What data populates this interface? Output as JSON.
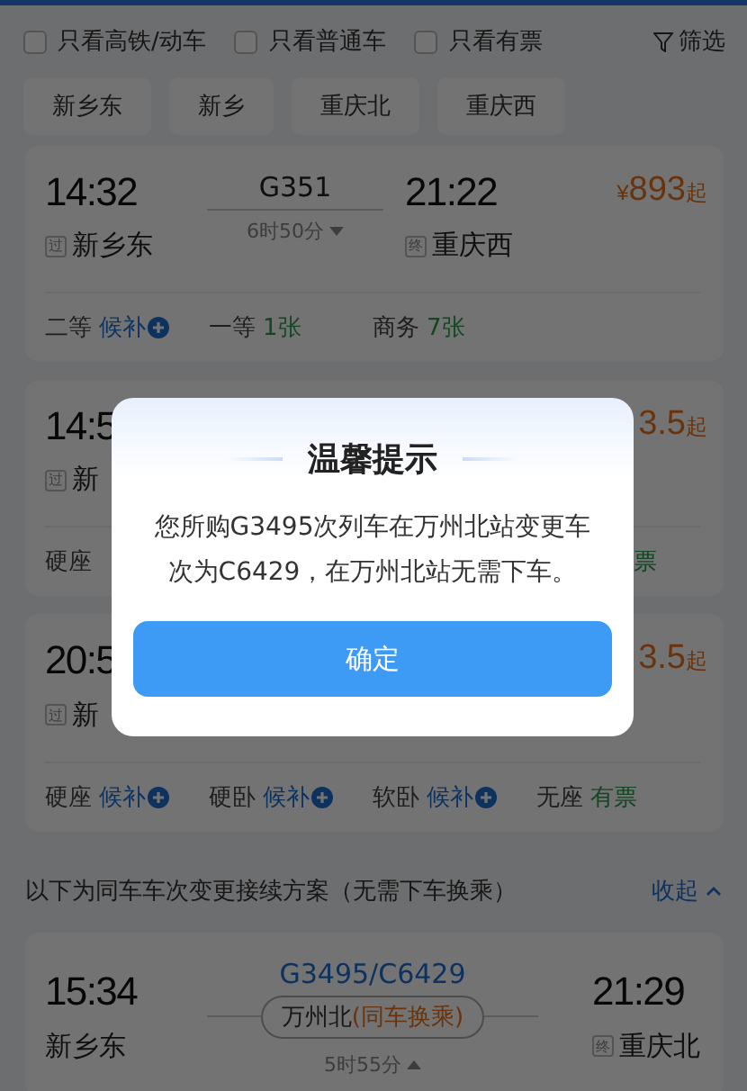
{
  "filters": [
    {
      "label": "只看高铁/动车",
      "checked": false
    },
    {
      "label": "只看普通车",
      "checked": false
    },
    {
      "label": "只看有票",
      "checked": false
    }
  ],
  "filter_button": "筛选",
  "stations": [
    "新乡东",
    "新乡",
    "重庆北",
    "重庆西"
  ],
  "trains": [
    {
      "kind": "full",
      "dep_time": "14:32",
      "dep_badge": "过",
      "dep_station": "新乡东",
      "train": "G351",
      "duration": "6时50分",
      "arr_time": "21:22",
      "arr_badge": "终",
      "arr_station": "重庆西",
      "price_symbol": "¥",
      "price": "893",
      "price_suffix": "起",
      "seats": [
        {
          "name": "二等",
          "status": "候补",
          "kind": "waitlist"
        },
        {
          "name": "一等",
          "status": "1张",
          "kind": "available"
        },
        {
          "name": "商务",
          "status": "7张",
          "kind": "available"
        }
      ]
    },
    {
      "kind": "partial",
      "dep_time": "14:5",
      "dep_badge": "过",
      "dep_station": "新",
      "price": "3.5",
      "price_suffix": "起",
      "seats": [
        {
          "name": "硬座"
        },
        {
          "status": "票",
          "kind": "available"
        }
      ]
    },
    {
      "kind": "partial",
      "dep_time": "20:5",
      "dep_badge": "过",
      "dep_station": "新",
      "price": "3.5",
      "price_suffix": "起",
      "seats": [
        {
          "name": "硬座",
          "status": "候补",
          "kind": "waitlist"
        },
        {
          "name": "硬卧",
          "status": "候补",
          "kind": "waitlist"
        },
        {
          "name": "软卧",
          "status": "候补",
          "kind": "waitlist"
        },
        {
          "name": "无座",
          "status": "有票",
          "kind": "available"
        }
      ]
    }
  ],
  "transfer_section": {
    "title": "以下为同车车次变更接续方案（无需下车换乘）",
    "toggle": "收起",
    "card": {
      "dep_time": "15:34",
      "dep_station": "新乡东",
      "train": "G3495/C6429",
      "via_station": "万州北",
      "via_note": "(同车换乘)",
      "duration": "5时55分",
      "arr_time": "21:29",
      "arr_badge": "终",
      "arr_station": "重庆北"
    }
  },
  "dialog": {
    "title": "温馨提示",
    "message": "您所购G3495次列车在万州北站变更车次为C6429，在万州北站无需下车。",
    "button": "确定"
  }
}
